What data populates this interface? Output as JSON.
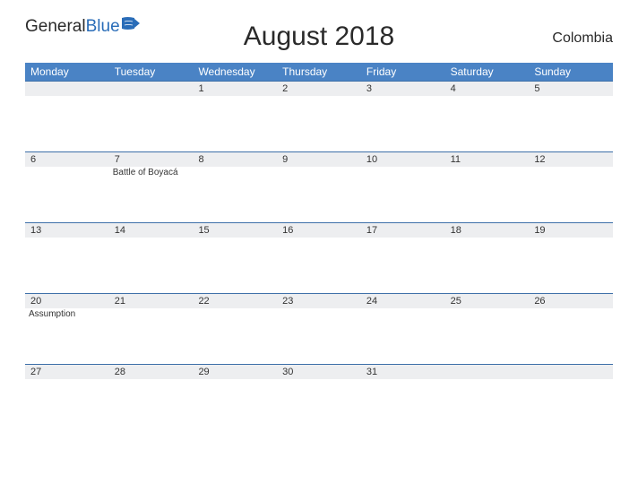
{
  "logo": {
    "part1": "General",
    "part2": "Blue"
  },
  "title": "August 2018",
  "country": "Colombia",
  "weekdays": [
    "Monday",
    "Tuesday",
    "Wednesday",
    "Thursday",
    "Friday",
    "Saturday",
    "Sunday"
  ],
  "weeks": [
    {
      "days": [
        "",
        "",
        "1",
        "2",
        "3",
        "4",
        "5"
      ],
      "events": [
        "",
        "",
        "",
        "",
        "",
        "",
        ""
      ]
    },
    {
      "days": [
        "6",
        "7",
        "8",
        "9",
        "10",
        "11",
        "12"
      ],
      "events": [
        "",
        "Battle of Boyacá",
        "",
        "",
        "",
        "",
        ""
      ]
    },
    {
      "days": [
        "13",
        "14",
        "15",
        "16",
        "17",
        "18",
        "19"
      ],
      "events": [
        "",
        "",
        "",
        "",
        "",
        "",
        ""
      ]
    },
    {
      "days": [
        "20",
        "21",
        "22",
        "23",
        "24",
        "25",
        "26"
      ],
      "events": [
        "Assumption",
        "",
        "",
        "",
        "",
        "",
        ""
      ]
    },
    {
      "days": [
        "27",
        "28",
        "29",
        "30",
        "31",
        "",
        ""
      ],
      "events": [
        "",
        "",
        "",
        "",
        "",
        "",
        ""
      ]
    }
  ]
}
